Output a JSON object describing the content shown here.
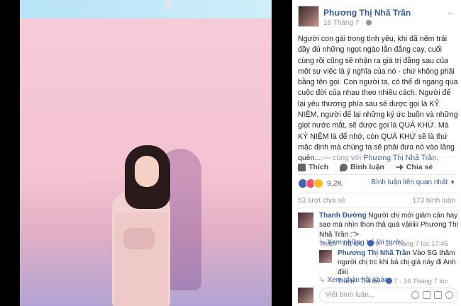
{
  "post": {
    "author": "Phương Thị Nhã Trần",
    "date": "16 Tháng 7 ·",
    "text": "Người con gái trong tình yêu, khi đã nếm trải đầy đủ những ngọt ngào lẫn đắng cay, cuối cùng rồi cũng sẽ nhận ra giá trị đằng sau của một sự việc là ý nghĩa của nó - chứ không phải bằng tên gọi. Con người ta, có thể đi ngang qua cuộc đời của nhau theo nhiều cách. Người để lại yêu thương phía sau sẽ được gọi là KỶ NIỆM, người để lại những ký ức buồn và những giọt nước mắt, sẽ được gọi là QUÁ KHỨ. Mà KỶ NIỆM là để nhớ, còn QUÁ KHỨ sẽ là thứ mặc định mà chúng ta sẽ phải đưa nó vào lãng quên...",
    "with_prefix": "— cùng với",
    "with_name": "Phương Thị Nhã Trần."
  },
  "actions": {
    "like": "Thích",
    "comment": "Bình luận",
    "share": "Chia sẻ"
  },
  "reactions": {
    "count": "9,2K",
    "sort_label": "Bình luận liên quan nhất"
  },
  "stats": {
    "shares": "53 lượt chia sẻ",
    "comments": "173 bình luận"
  },
  "comments": [
    {
      "name": "Thanh Đường",
      "text": "Người chị mới giảm cân hay sao mà nhìn thon thả quá vậiiiiii Phương Thị Nhã Trần :\">",
      "like": "Thích",
      "reply": "Trả lời",
      "likes": "9",
      "time": "16 Tháng 7 lúc 17:45",
      "more_replies": "Xem những trả lời trước",
      "replies": [
        {
          "name": "Phương Thị Nhã Trần",
          "text": "Vào SG thăm người chị trc khi bà chị già này đi Anh điiii",
          "like": "Thích",
          "reply": "Trả lời",
          "likes": "7",
          "time": "16 Tháng 7 lúc 18:56"
        }
      ]
    }
  ],
  "more_feedback": "Xem phản hồi khác",
  "write_comment": {
    "placeholder": "Viết bình luận..."
  },
  "colors": {
    "link": "#365899",
    "muted": "#90949c",
    "like_blue": "#4267b2"
  }
}
